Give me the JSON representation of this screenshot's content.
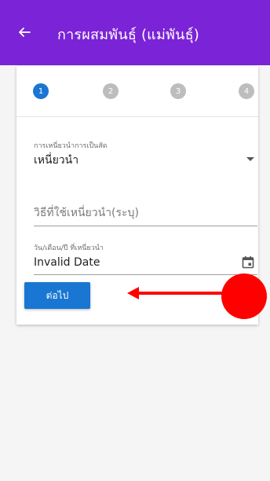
{
  "appbar": {
    "title": "การผสมพันธุ์ (แม่พันธุ์)",
    "back_icon": "arrow-left-icon",
    "background_color": "#7b23d6"
  },
  "stepper": {
    "steps": [
      "1",
      "2",
      "3",
      "4"
    ],
    "active_step": 1,
    "active_color": "#1976d2",
    "inactive_color": "#bdbdbd"
  },
  "form": {
    "induction_type": {
      "label": "การเหนี่ยวนำการเป็นสัด",
      "value": "เหนี่ยวนำ"
    },
    "method": {
      "placeholder": "วิธีที่ใช้เหนี่ยวนำ(ระบุ)"
    },
    "date": {
      "label": "วัน/เดือน/ปี ที่เหนี่ยวนำ",
      "value": "Invalid Date",
      "icon": "calendar-icon"
    }
  },
  "actions": {
    "next_label": "ต่อไป",
    "button_color": "#1976d2"
  },
  "annotation": {
    "arrow_color": "#ff0000",
    "dot_color": "#ff0000"
  }
}
